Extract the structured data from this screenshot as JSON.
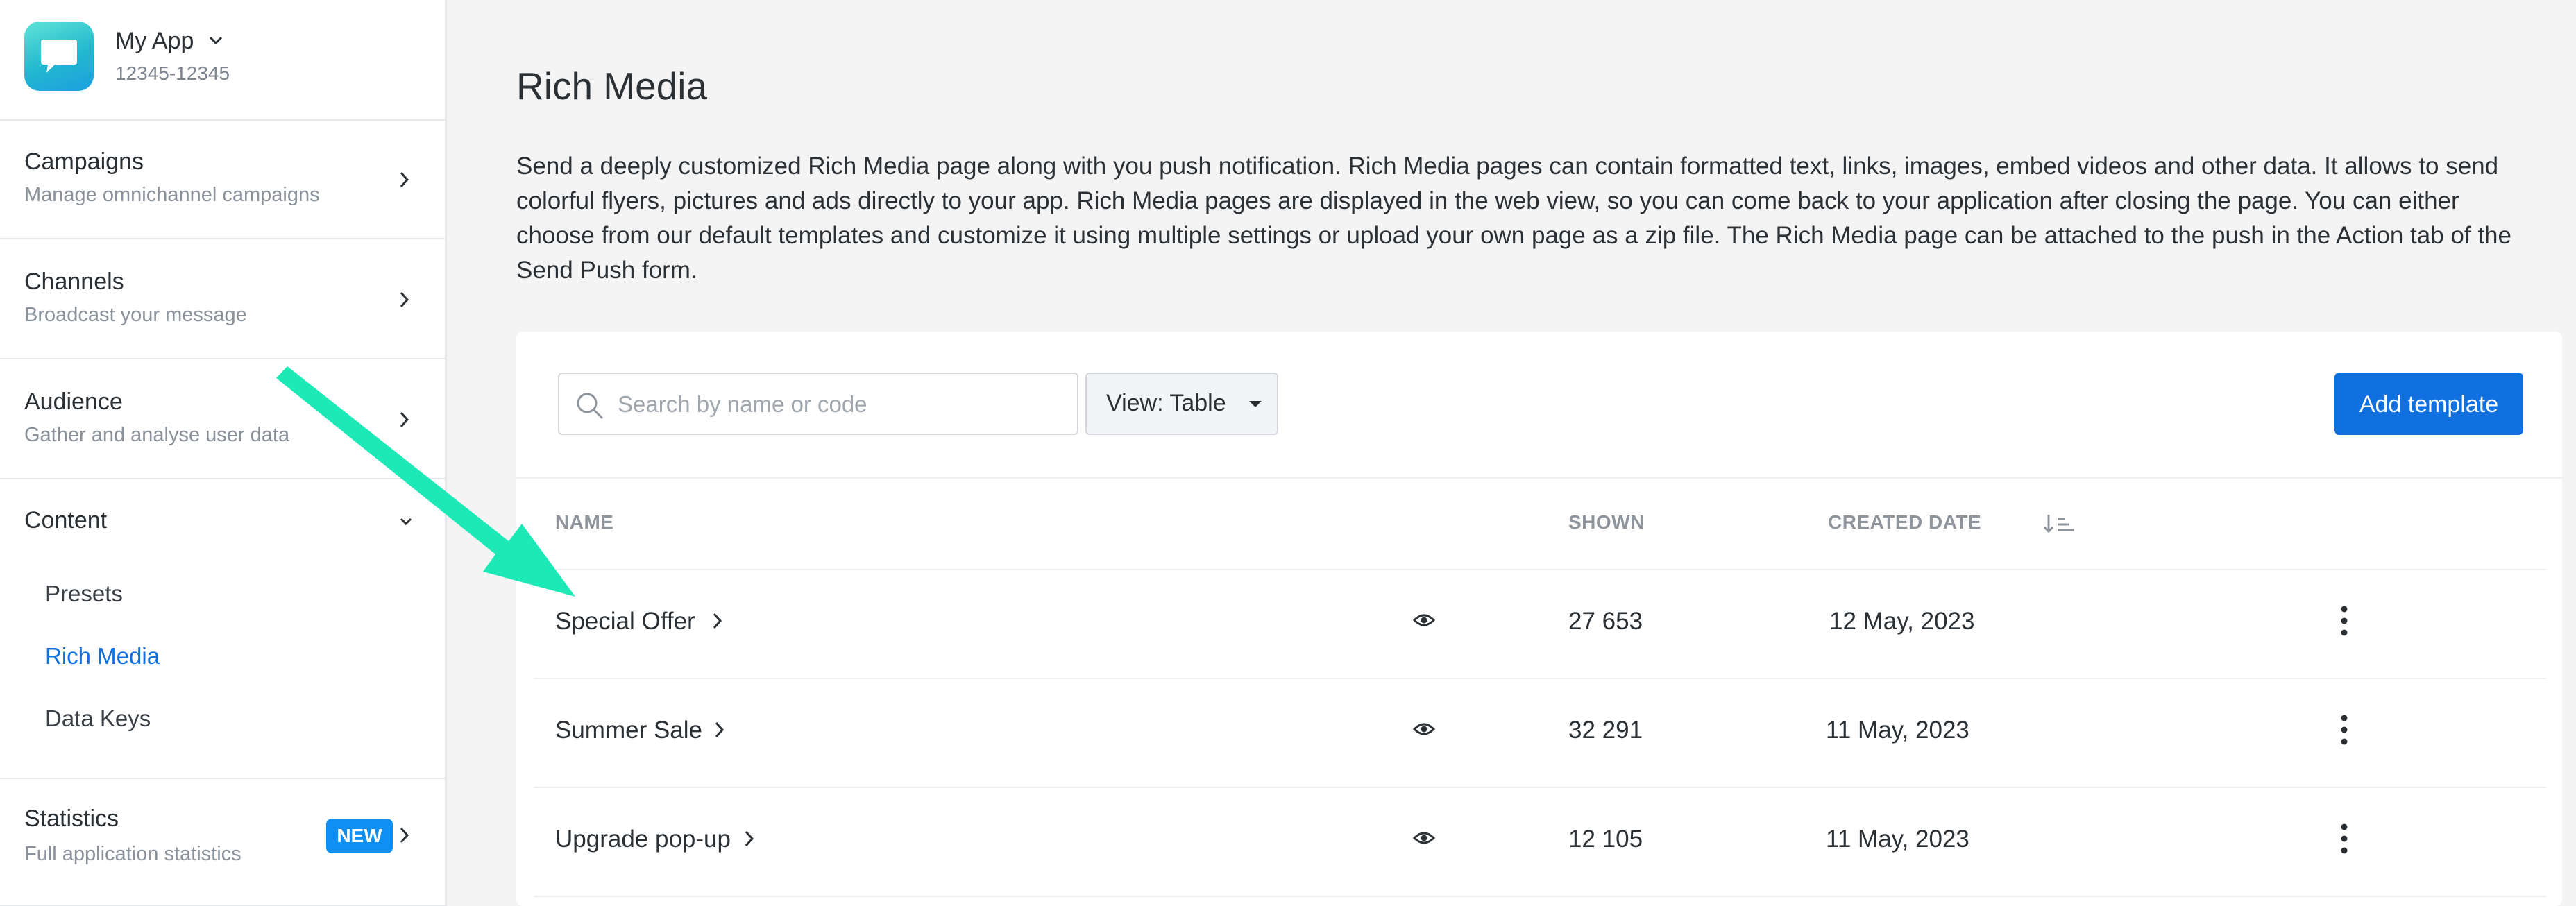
{
  "app": {
    "name": "My App",
    "id": "12345-12345"
  },
  "sidebar": {
    "sections": [
      {
        "title": "Campaigns",
        "subtitle": "Manage omnichannel campaigns"
      },
      {
        "title": "Channels",
        "subtitle": "Broadcast your message"
      },
      {
        "title": "Audience",
        "subtitle": "Gather and analyse user data"
      },
      {
        "title": "Content",
        "subtitle": ""
      },
      {
        "title": "Statistics",
        "subtitle": "Full application statistics",
        "badge": "NEW"
      }
    ],
    "content_items": [
      "Presets",
      "Rich Media",
      "Data Keys"
    ],
    "active_item": "Rich Media"
  },
  "page": {
    "title": "Rich Media",
    "description": "Send a deeply customized Rich Media page along with you push notification. Rich Media pages can contain formatted text, links, images, embed videos and other data. It allows to send colorful flyers, pictures and ads directly to your app. Rich Media pages are displayed in the web view, so you can come back to your application after closing the page. You can either choose from our default templates and customize it using multiple settings or upload your own page as a zip file. The Rich Media page can be attached to the push in the Action tab of the Send Push form."
  },
  "toolbar": {
    "search_placeholder": "Search by name or code",
    "view_label": "View: Table",
    "add_button": "Add template"
  },
  "table": {
    "columns": [
      "NAME",
      "SHOWN",
      "CREATED DATE"
    ],
    "rows": [
      {
        "name": "Special Offer",
        "shown": "27 653",
        "created": "12 May, 2023"
      },
      {
        "name": "Summer Sale",
        "shown": "32 291",
        "created": "11 May, 2023"
      },
      {
        "name": "Upgrade pop-up",
        "shown": "12 105",
        "created": "11 May, 2023"
      }
    ]
  },
  "colors": {
    "accent": "#1070e0",
    "badge": "#0f8ff2",
    "annotation_arrow": "#1de9b6"
  }
}
